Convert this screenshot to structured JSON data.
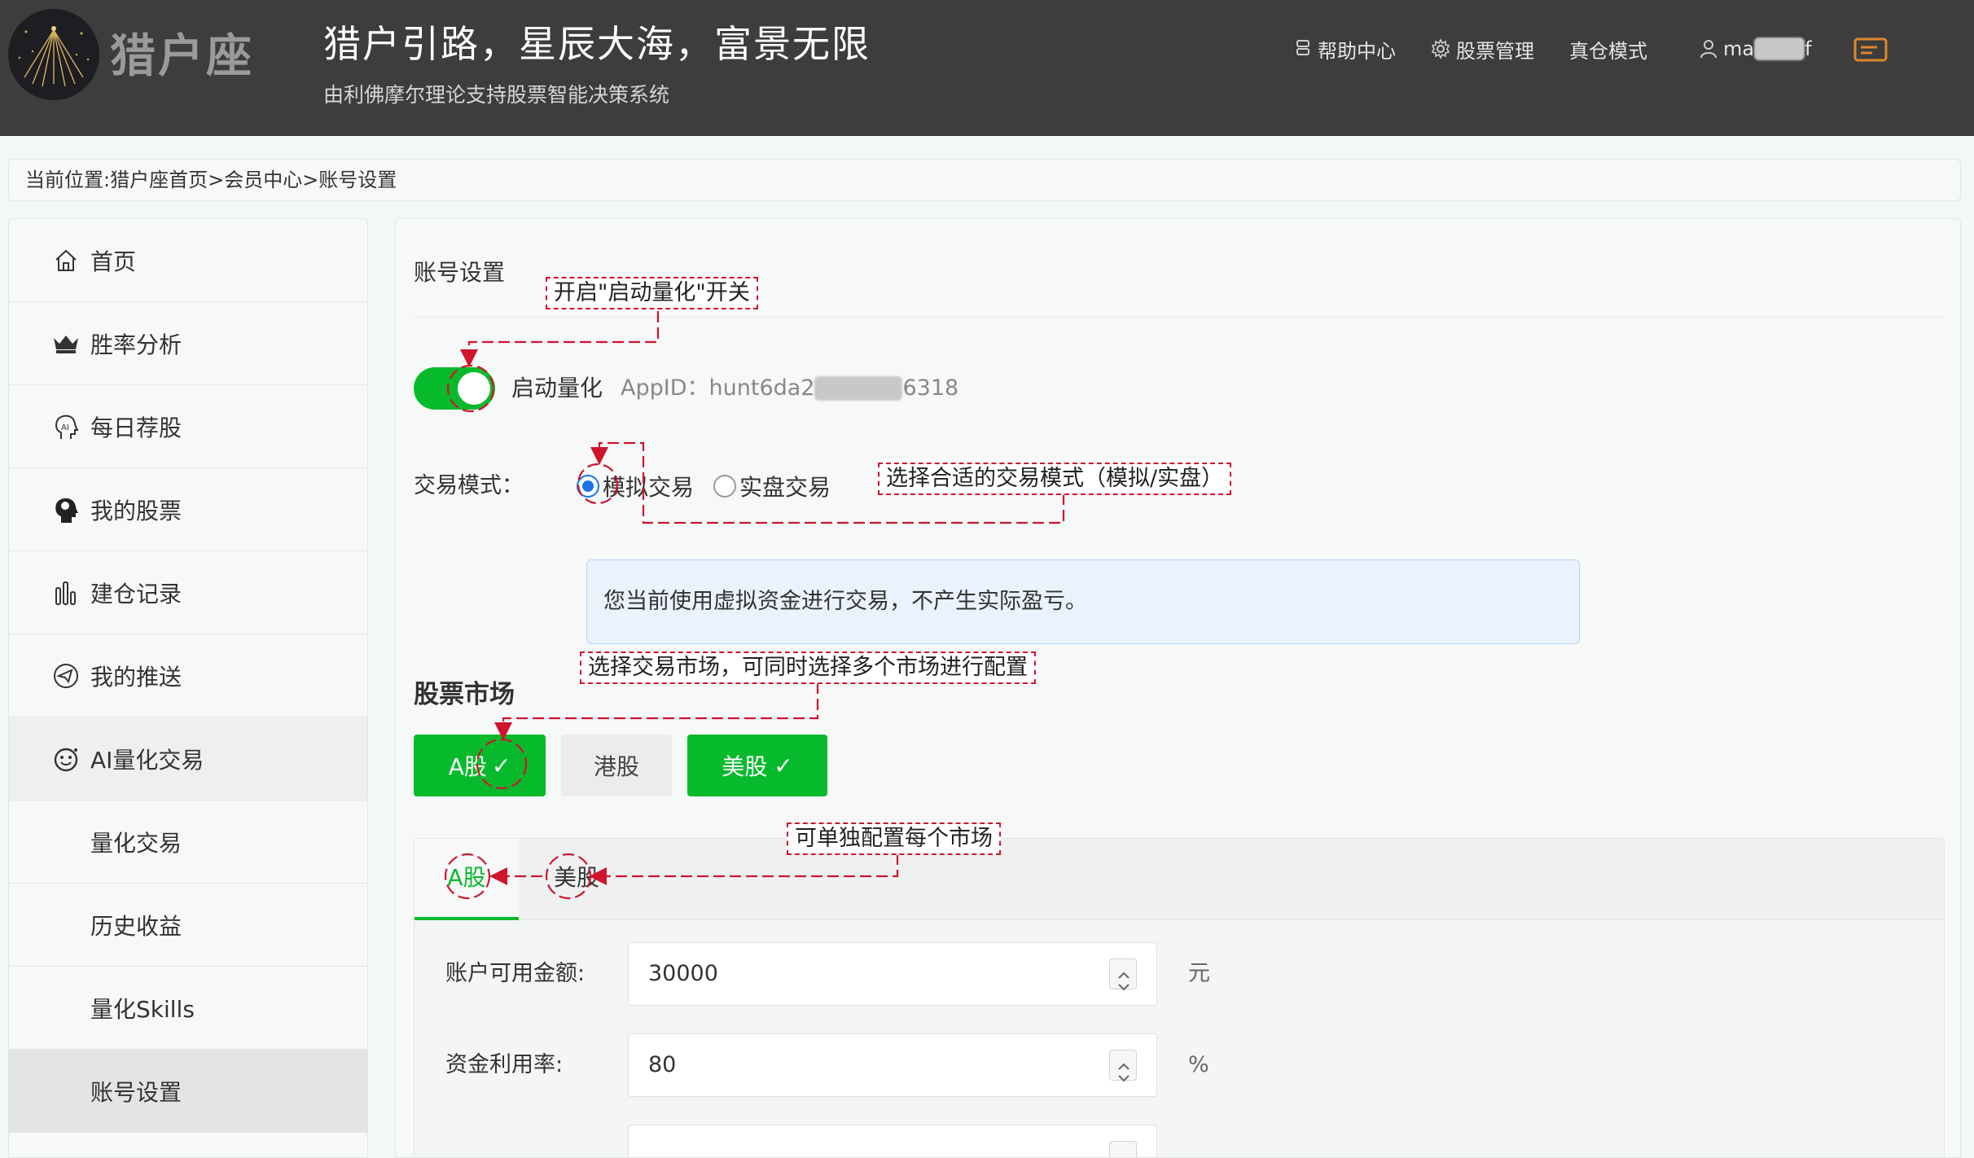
{
  "header": {
    "logo_text": "猎户座",
    "slogan": "猎户引路，星辰大海，富景无限",
    "subslogan": "由利佛摩尔理论支持股票智能决策系统",
    "nav": {
      "help": "帮助中心",
      "stock_manage": "股票管理",
      "real_mode": "真仓模式"
    },
    "user": {
      "prefix": "ma",
      "suffix": "f"
    }
  },
  "breadcrumb": "当前位置:猎户座首页>会员中心>账号设置",
  "sidebar": {
    "items": [
      {
        "label": "首页",
        "icon": "home-icon"
      },
      {
        "label": "胜率分析",
        "icon": "crown-icon"
      },
      {
        "label": "每日荐股",
        "icon": "ai-head-icon"
      },
      {
        "label": "我的股票",
        "icon": "brain-head-icon"
      },
      {
        "label": "建仓记录",
        "icon": "bar-chart-icon"
      },
      {
        "label": "我的推送",
        "icon": "push-icon"
      },
      {
        "label": "AI量化交易",
        "icon": "robot-face-icon"
      },
      {
        "label": "量化交易"
      },
      {
        "label": "历史收益"
      },
      {
        "label": "量化Skills"
      },
      {
        "label": "账号设置"
      }
    ]
  },
  "settings": {
    "title": "账号设置",
    "switch_label": "启动量化",
    "switch_on": true,
    "appid_label": "AppID：",
    "appid_prefix": "hunt6da2",
    "appid_suffix": "6318",
    "mode_label": "交易模式：",
    "mode_sim": "模拟交易",
    "mode_real": "实盘交易",
    "mode_selected": "模拟交易",
    "info_text": "您当前使用虚拟资金进行交易，不产生实际盈亏。",
    "market_title": "股票市场",
    "markets": {
      "a": {
        "label": "A股",
        "mark": "✓",
        "selected": true
      },
      "hk": {
        "label": "港股",
        "selected": false
      },
      "us": {
        "label": "美股",
        "mark": "✓",
        "selected": true
      }
    },
    "tabs": {
      "a": "A股",
      "us": "美股",
      "active": "A股"
    },
    "fields": [
      {
        "label": "账户可用金额:",
        "value": "30000",
        "unit": "元"
      },
      {
        "label": "资金利用率:",
        "value": "80",
        "unit": "%"
      },
      {
        "label": "",
        "value": "",
        "unit": ""
      }
    ]
  },
  "annotations": {
    "switch_note": "开启\"启动量化\"开关",
    "mode_note": "选择合适的交易模式（模拟/实盘）",
    "market_note": "选择交易市场，可同时选择多个市场进行配置",
    "tab_note": "可单独配置每个市场"
  },
  "colors": {
    "header_bg": "#3d3d3d",
    "accent_green": "#07ba2c",
    "radio_blue": "#1a73e8",
    "info_bg": "#e9f2fd",
    "annotation_red": "#d0142c"
  }
}
